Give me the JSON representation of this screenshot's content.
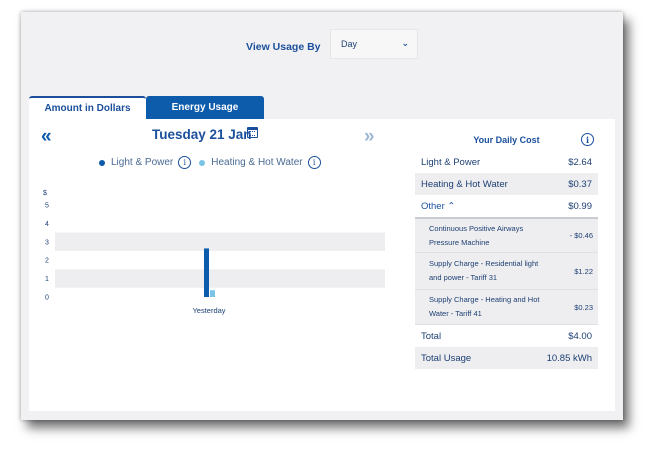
{
  "header": {
    "view_by_label": "View Usage By",
    "view_by_value": "Day",
    "chevron": "⌄"
  },
  "tabs": [
    {
      "label": "Amount in Dollars",
      "active": true
    },
    {
      "label": "Energy Usage",
      "active": false
    }
  ],
  "date_nav": {
    "prev": "«",
    "next": "»",
    "date": "Tuesday 21 Jan"
  },
  "legend": [
    {
      "label": "Light & Power",
      "color": "#0d5bab"
    },
    {
      "label": "Heating & Hot Water",
      "color": "#7cc4e6"
    }
  ],
  "chart_data": {
    "type": "bar",
    "categories": [
      "Yesterday"
    ],
    "series": [
      {
        "name": "Light & Power",
        "values": [
          2.64
        ],
        "color": "#0d5bab"
      },
      {
        "name": "Heating & Hot Water",
        "values": [
          0.37
        ],
        "color": "#7cc4e6"
      }
    ],
    "ylabel": "$",
    "yticks": [
      "0",
      "1",
      "2",
      "3",
      "4",
      "5"
    ],
    "ylim": [
      0,
      5
    ]
  },
  "cost": {
    "title": "Your Daily Cost",
    "light_power": {
      "label": "Light & Power",
      "value": "$2.64"
    },
    "heating": {
      "label": "Heating & Hot Water",
      "value": "$0.37"
    },
    "other": {
      "label": "Other",
      "value": "$0.99",
      "chevron": "⌃"
    },
    "sub_items": [
      {
        "label": "Continuous Positive Airways Pressure Machine",
        "value": "- $0.46"
      },
      {
        "label": "Supply Charge - Residential light and power - Tariff 31",
        "value": "$1.22"
      },
      {
        "label": "Supply Charge - Heating and Hot Water - Tariff 41",
        "value": "$0.23"
      }
    ],
    "total": {
      "label": "Total",
      "value": "$4.00"
    },
    "total_usage": {
      "label": "Total Usage",
      "value": "10.85 kWh"
    }
  },
  "icons": {
    "info": "i"
  }
}
